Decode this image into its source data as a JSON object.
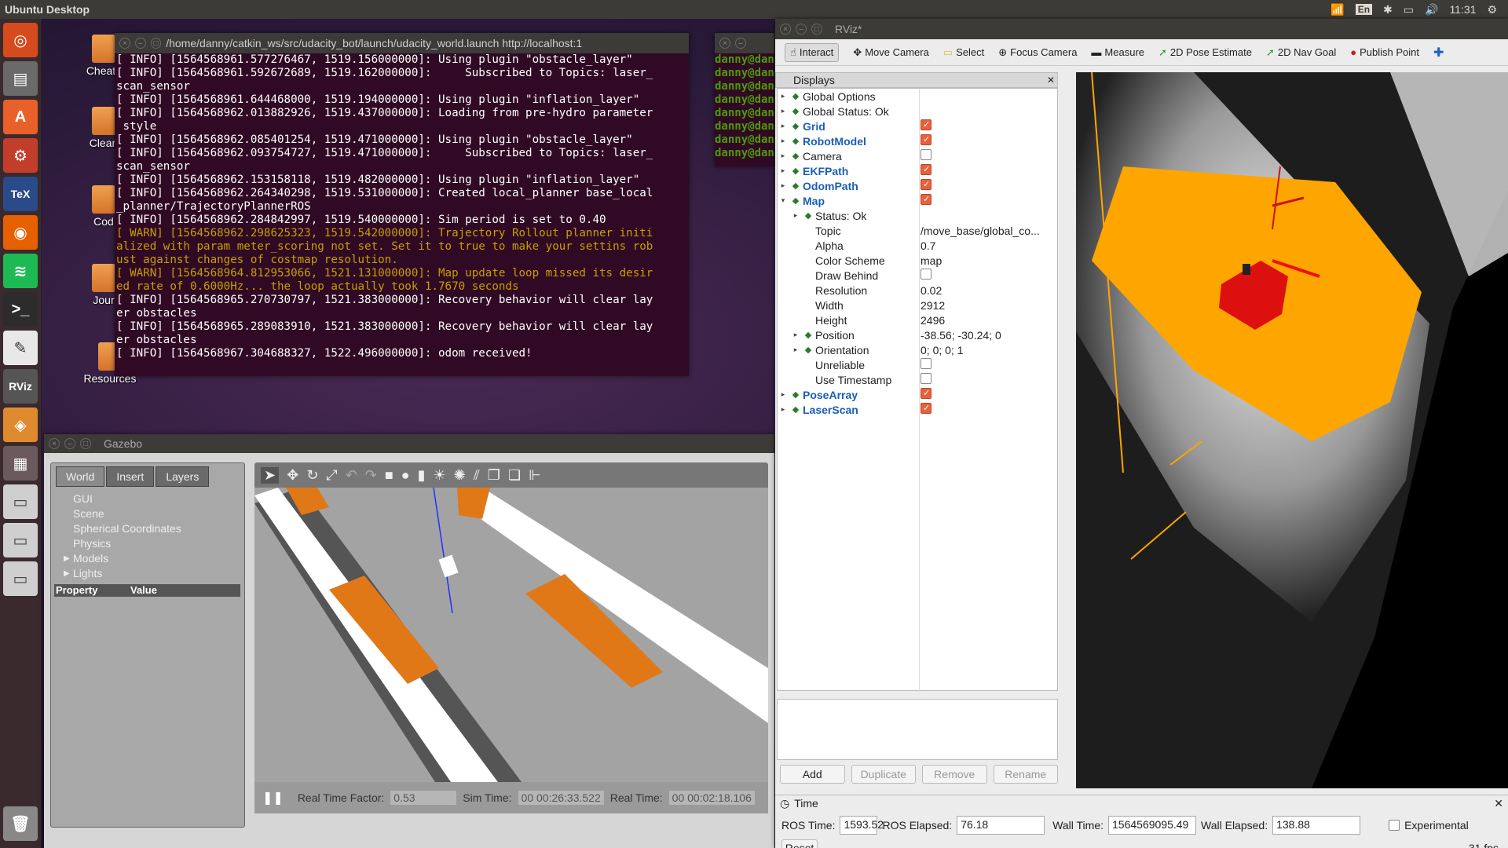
{
  "topbar": {
    "title": "Ubuntu Desktop",
    "lang": "En",
    "time": "11:31"
  },
  "desktop_icons": [
    "Cheats",
    "Clean",
    "Cod",
    "Jour",
    "Resources"
  ],
  "terminal": {
    "title": "/home/danny/catkin_ws/src/udacity_bot/launch/udacity_world.launch http://localhost:1",
    "lines": [
      {
        "t": "[ INFO] [1564568961.577276467, 1519.156000000]: Using plugin \"obstacle_layer\"",
        "w": false
      },
      {
        "t": "[ INFO] [1564568961.592672689, 1519.162000000]:     Subscribed to Topics: laser_",
        "w": false
      },
      {
        "t": "scan_sensor",
        "w": false
      },
      {
        "t": "[ INFO] [1564568961.644468000, 1519.194000000]: Using plugin \"inflation_layer\"",
        "w": false
      },
      {
        "t": "[ INFO] [1564568962.013882926, 1519.437000000]: Loading from pre-hydro parameter",
        "w": false
      },
      {
        "t": " style",
        "w": false
      },
      {
        "t": "[ INFO] [1564568962.085401254, 1519.471000000]: Using plugin \"obstacle_layer\"",
        "w": false
      },
      {
        "t": "[ INFO] [1564568962.093754727, 1519.471000000]:     Subscribed to Topics: laser_",
        "w": false
      },
      {
        "t": "scan_sensor",
        "w": false
      },
      {
        "t": "[ INFO] [1564568962.153158118, 1519.482000000]: Using plugin \"inflation_layer\"",
        "w": false
      },
      {
        "t": "[ INFO] [1564568962.264340298, 1519.531000000]: Created local_planner base_local",
        "w": false
      },
      {
        "t": "_planner/TrajectoryPlannerROS",
        "w": false
      },
      {
        "t": "[ INFO] [1564568962.284842997, 1519.540000000]: Sim period is set to 0.40",
        "w": false
      },
      {
        "t": "[ WARN] [1564568962.298625323, 1519.542000000]: Trajectory Rollout planner initi",
        "w": true
      },
      {
        "t": "alized with param meter_scoring not set. Set it to true to make your settins rob",
        "w": true
      },
      {
        "t": "ust against changes of costmap resolution.",
        "w": true
      },
      {
        "t": "[ WARN] [1564568964.812953066, 1521.131000000]: Map update loop missed its desir",
        "w": true
      },
      {
        "t": "ed rate of 0.6000Hz... the loop actually took 1.7670 seconds",
        "w": true
      },
      {
        "t": "[ INFO] [1564568965.270730797, 1521.383000000]: Recovery behavior will clear lay",
        "w": false
      },
      {
        "t": "er obstacles",
        "w": false
      },
      {
        "t": "[ INFO] [1564568965.289083910, 1521.383000000]: Recovery behavior will clear lay",
        "w": false
      },
      {
        "t": "er obstacles",
        "w": false
      },
      {
        "t": "[ INFO] [1564568967.304688327, 1522.496000000]: odom received!",
        "w": false
      }
    ]
  },
  "terminal2": {
    "prompt": "danny@dan"
  },
  "gazebo": {
    "title": "Gazebo",
    "tabs": [
      "World",
      "Insert",
      "Layers"
    ],
    "tree": [
      "GUI",
      "Scene",
      "Spherical Coordinates",
      "Physics",
      "Models",
      "Lights"
    ],
    "prop_headers": [
      "Property",
      "Value"
    ],
    "rtf_label": "Real Time Factor:",
    "rtf": "0.53",
    "sim_label": "Sim Time:",
    "sim": "00 00:26:33.522",
    "real_label": "Real Time:",
    "real": "00 00:02:18.106"
  },
  "rviz": {
    "title": "RViz*",
    "tools": [
      "Interact",
      "Move Camera",
      "Select",
      "Focus Camera",
      "Measure",
      "2D Pose Estimate",
      "2D Nav Goal",
      "Publish Point"
    ],
    "displays_label": "Displays",
    "rows": [
      {
        "name": "Global Options",
        "value": "",
        "indent": 0,
        "blue": false,
        "check": null,
        "arrow": "▸"
      },
      {
        "name": "Global Status: Ok",
        "value": "",
        "indent": 0,
        "blue": false,
        "check": null,
        "arrow": "▸"
      },
      {
        "name": "Grid",
        "value": "",
        "indent": 0,
        "blue": true,
        "check": true,
        "arrow": "▸"
      },
      {
        "name": "RobotModel",
        "value": "",
        "indent": 0,
        "blue": true,
        "check": true,
        "arrow": "▸"
      },
      {
        "name": "Camera",
        "value": "",
        "indent": 0,
        "blue": false,
        "check": false,
        "arrow": "▸"
      },
      {
        "name": "EKFPath",
        "value": "",
        "indent": 0,
        "blue": true,
        "check": true,
        "arrow": "▸"
      },
      {
        "name": "OdomPath",
        "value": "",
        "indent": 0,
        "blue": true,
        "check": true,
        "arrow": "▸"
      },
      {
        "name": "Map",
        "value": "",
        "indent": 0,
        "blue": true,
        "check": true,
        "arrow": "▾"
      },
      {
        "name": "Status: Ok",
        "value": "",
        "indent": 1,
        "blue": false,
        "check": null,
        "arrow": "▸"
      },
      {
        "name": "Topic",
        "value": "/move_base/global_co...",
        "indent": 1,
        "blue": false,
        "check": null,
        "arrow": ""
      },
      {
        "name": "Alpha",
        "value": "0.7",
        "indent": 1,
        "blue": false,
        "check": null,
        "arrow": ""
      },
      {
        "name": "Color Scheme",
        "value": "map",
        "indent": 1,
        "blue": false,
        "check": null,
        "arrow": ""
      },
      {
        "name": "Draw Behind",
        "value": "",
        "indent": 1,
        "blue": false,
        "check": false,
        "arrow": ""
      },
      {
        "name": "Resolution",
        "value": "0.02",
        "indent": 1,
        "blue": false,
        "check": null,
        "arrow": ""
      },
      {
        "name": "Width",
        "value": "2912",
        "indent": 1,
        "blue": false,
        "check": null,
        "arrow": ""
      },
      {
        "name": "Height",
        "value": "2496",
        "indent": 1,
        "blue": false,
        "check": null,
        "arrow": ""
      },
      {
        "name": "Position",
        "value": "-38.56; -30.24; 0",
        "indent": 1,
        "blue": false,
        "check": null,
        "arrow": "▸"
      },
      {
        "name": "Orientation",
        "value": "0; 0; 0; 1",
        "indent": 1,
        "blue": false,
        "check": null,
        "arrow": "▸"
      },
      {
        "name": "Unreliable",
        "value": "",
        "indent": 1,
        "blue": false,
        "check": false,
        "arrow": ""
      },
      {
        "name": "Use Timestamp",
        "value": "",
        "indent": 1,
        "blue": false,
        "check": false,
        "arrow": ""
      },
      {
        "name": "PoseArray",
        "value": "",
        "indent": 0,
        "blue": true,
        "check": true,
        "arrow": "▸"
      },
      {
        "name": "LaserScan",
        "value": "",
        "indent": 0,
        "blue": true,
        "check": true,
        "arrow": "▸"
      }
    ],
    "buttons": [
      "Add",
      "Duplicate",
      "Remove",
      "Rename"
    ],
    "time": {
      "header": "Time",
      "ros_time_label": "ROS Time:",
      "ros_time": "1593.52",
      "ros_elapsed_label": "ROS Elapsed:",
      "ros_elapsed": "76.18",
      "wall_time_label": "Wall Time:",
      "wall_time": "1564569095.49",
      "wall_elapsed_label": "Wall Elapsed:",
      "wall_elapsed": "138.88",
      "experimental": "Experimental",
      "reset": "Reset",
      "fps": "31 fps"
    }
  }
}
